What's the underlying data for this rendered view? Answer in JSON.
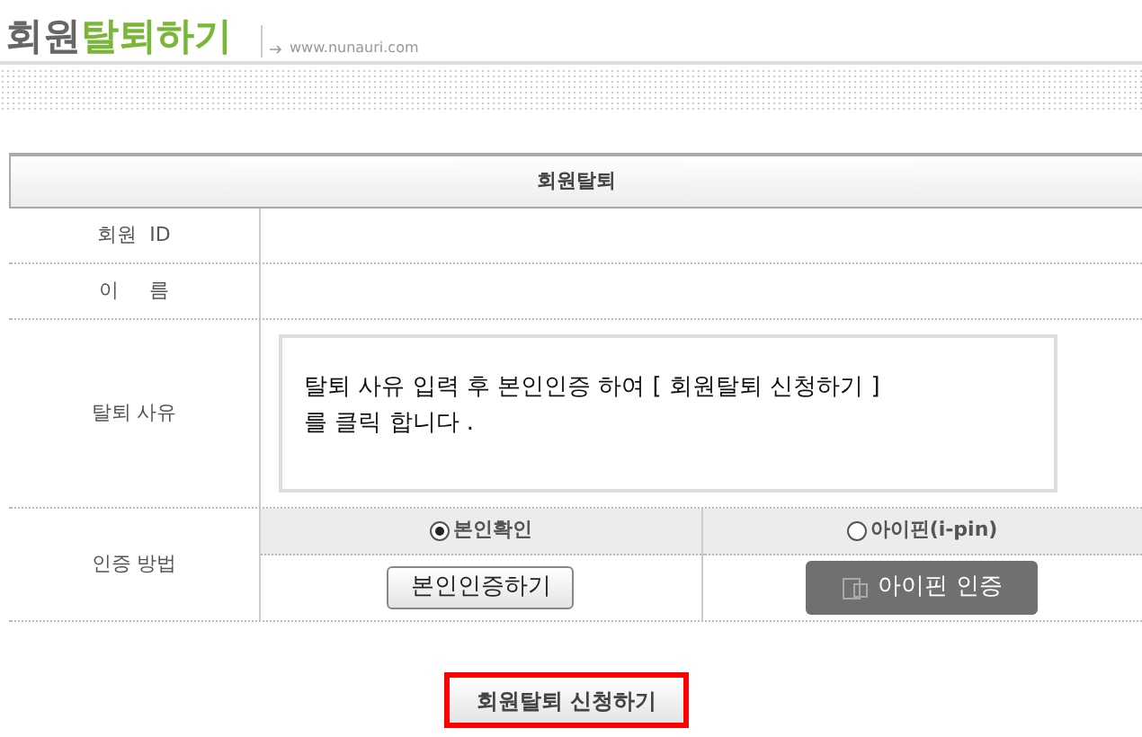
{
  "title": {
    "prefix": "회원",
    "main": "탈퇴하기"
  },
  "site_url": "www.nunauri.com",
  "table": {
    "heading": "회원탈퇴",
    "rows": [
      {
        "label": "회원  ID",
        "kind": "text"
      },
      {
        "label": "이     름",
        "kind": "text"
      },
      {
        "label": "탈퇴 사유",
        "kind": "textarea",
        "value": "탈퇴 사유 입력 후 본인인증 하여 [ 회원탈퇴 신청하기 ]\n를 클릭 합니다 ."
      },
      {
        "label": "인증 방법",
        "kind": "auth"
      }
    ]
  },
  "auth_options": [
    {
      "label": "본인확인",
      "selected": true,
      "button": "본인인증하기",
      "kind": "plain"
    },
    {
      "label": "아이핀(i-pin)",
      "selected": false,
      "button": "아이핀 인증",
      "kind": "ipin"
    }
  ],
  "submit_button": "회원탈퇴 신청하기"
}
